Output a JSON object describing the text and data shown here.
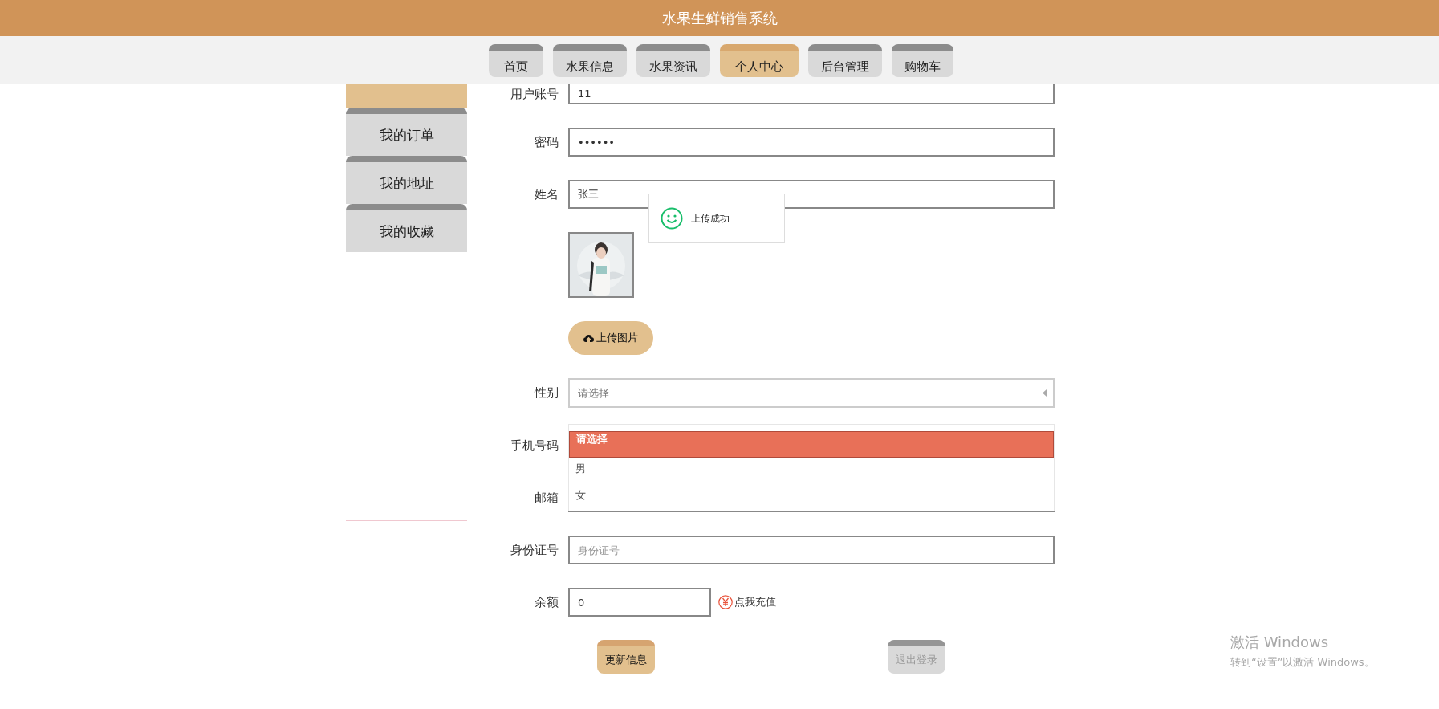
{
  "header": {
    "title": "水果生鲜销售系统"
  },
  "nav": [
    {
      "label": "首页",
      "selected": false
    },
    {
      "label": "水果信息",
      "selected": false
    },
    {
      "label": "水果资讯",
      "selected": false
    },
    {
      "label": "个人中心",
      "selected": true
    },
    {
      "label": "后台管理",
      "selected": false
    },
    {
      "label": "购物车",
      "selected": false
    }
  ],
  "sidebar": [
    {
      "selected": true
    },
    {
      "label": "我的订单",
      "selected": false
    },
    {
      "label": "我的地址",
      "selected": false
    },
    {
      "label": "我的收藏",
      "selected": false
    }
  ],
  "form": {
    "rows": [
      {
        "kind": "input",
        "label": "用户账号",
        "value": "11"
      },
      {
        "kind": "input",
        "label": "密码",
        "value": "••••••"
      },
      {
        "kind": "input",
        "label": "姓名",
        "value": "张三"
      },
      {
        "kind": "avatar"
      },
      {
        "kind": "upload",
        "button": "上传图片"
      },
      {
        "kind": "select",
        "label": "性别",
        "placeholder": "请选择",
        "expanded": true,
        "options": [
          {
            "label": "请选择",
            "selected": true
          },
          {
            "label": "男",
            "selected": false
          },
          {
            "label": "女",
            "selected": false
          }
        ]
      },
      {
        "kind": "input",
        "label": "手机号码"
      },
      {
        "kind": "input",
        "label": "邮箱"
      },
      {
        "kind": "input",
        "label": "身份证号",
        "placeholder": "身份证号"
      },
      {
        "kind": "balance",
        "label": "余额",
        "value": "0",
        "link": "点我充值"
      }
    ],
    "actions": [
      {
        "label": "更新信息",
        "kind": "primary"
      },
      {
        "label": "退出登录",
        "kind": "muted"
      }
    ]
  },
  "toast": {
    "text": "上传成功"
  },
  "os_notice": {
    "title": "激活 Windows",
    "subtitle": "转到“设置”以激活 Windows。"
  }
}
